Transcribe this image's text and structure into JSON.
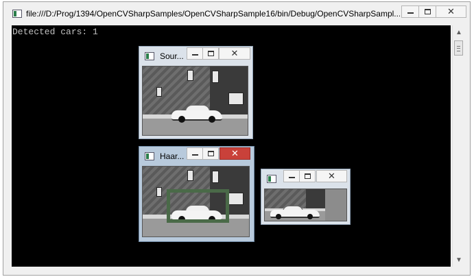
{
  "console": {
    "title": "file:///D:/Prog/1394/OpenCVSharpSamples/OpenCVSharpSample16/bin/Debug/OpenCVSharpSampl...",
    "output_line": "Detected cars: 1"
  },
  "windows": {
    "source": {
      "title": "Sour..."
    },
    "haar": {
      "title": "Haar..."
    },
    "crop": {
      "title": ""
    }
  },
  "caption": {
    "close_glyph": "✕"
  },
  "scrollbar": {
    "up_arrow": "▲",
    "down_arrow": "▼"
  },
  "colors": {
    "console_bg": "#000000",
    "console_text": "#c0c0c0",
    "close_active": "#c9413a",
    "detect_box": "#4a6a48"
  },
  "icons": [
    "console-app-icon",
    "minimize-icon",
    "maximize-icon",
    "close-icon",
    "scroll-up-icon",
    "scroll-down-icon"
  ]
}
